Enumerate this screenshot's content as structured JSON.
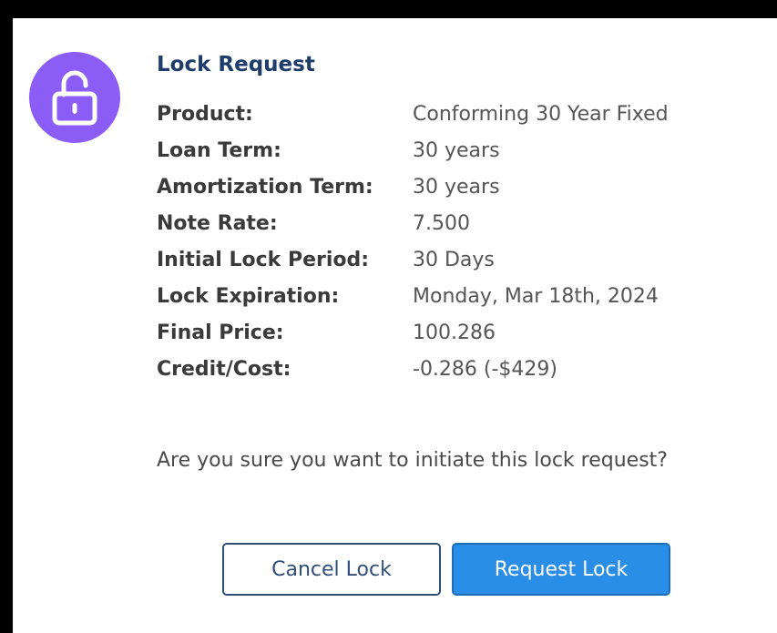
{
  "dialog": {
    "title": "Lock Request",
    "icon": "unlocked-padlock-icon",
    "accent_color": "#8b5cf6",
    "title_color": "#1f3d6b",
    "rows": [
      {
        "label": "Product:",
        "value": "Conforming 30 Year Fixed"
      },
      {
        "label": "Loan Term:",
        "value": "30 years"
      },
      {
        "label": "Amortization Term:",
        "value": "30 years"
      },
      {
        "label": "Note Rate:",
        "value": "7.500"
      },
      {
        "label": "Initial Lock Period:",
        "value": "30 Days"
      },
      {
        "label": "Lock Expiration:",
        "value": "Monday, Mar 18th, 2024"
      },
      {
        "label": "Final Price:",
        "value": "100.286"
      },
      {
        "label": "Credit/Cost:",
        "value": "-0.286 (-$429)"
      }
    ],
    "question": "Are you sure you want to initiate this lock request?",
    "buttons": {
      "cancel_label": "Cancel Lock",
      "request_label": "Request Lock",
      "request_color": "#2a8ee6"
    }
  }
}
